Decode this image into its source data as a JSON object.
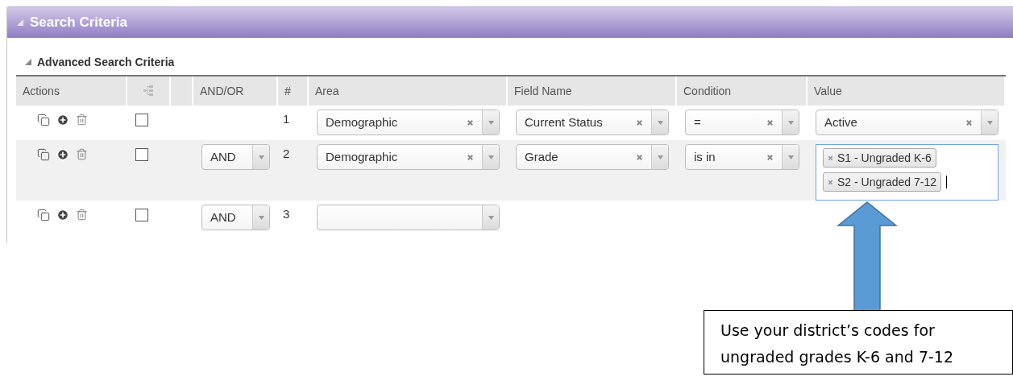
{
  "panel": {
    "title": "Search Criteria",
    "expanded": true
  },
  "section": {
    "title": "Advanced Search Criteria",
    "expanded": true
  },
  "table": {
    "columns": [
      {
        "kind": "text",
        "label": "Actions"
      },
      {
        "kind": "tree"
      },
      {
        "kind": "blank"
      },
      {
        "kind": "text",
        "label": "AND/OR"
      },
      {
        "kind": "text",
        "label": "#"
      },
      {
        "kind": "text",
        "label": "Area"
      },
      {
        "kind": "text",
        "label": "Field Name"
      },
      {
        "kind": "text",
        "label": "Condition"
      },
      {
        "kind": "text",
        "label": "Value"
      }
    ],
    "rows": [
      {
        "checked": false,
        "number": "1",
        "area": {
          "kind": "select",
          "value": "Demographic"
        },
        "field": {
          "kind": "select",
          "value": "Current Status"
        },
        "condition": {
          "kind": "select",
          "value": "="
        },
        "value": {
          "kind": "select",
          "value": "Active"
        }
      },
      {
        "checked": false,
        "logic": "AND",
        "number": "2",
        "area": {
          "kind": "select",
          "value": "Demographic"
        },
        "field": {
          "kind": "select",
          "value": "Grade"
        },
        "condition": {
          "kind": "select",
          "value": "is in"
        },
        "value": {
          "kind": "tags",
          "focused": true,
          "tags": [
            "S1 - Ungraded K-6",
            "S2 - Ungraded 7-12"
          ]
        }
      },
      {
        "checked": false,
        "logic": "AND",
        "number": "3",
        "area": {
          "kind": "select"
        }
      }
    ]
  },
  "callout": {
    "lines": [
      "Use your district’s codes for",
      "ungraded grades K-6 and 7-12"
    ]
  }
}
